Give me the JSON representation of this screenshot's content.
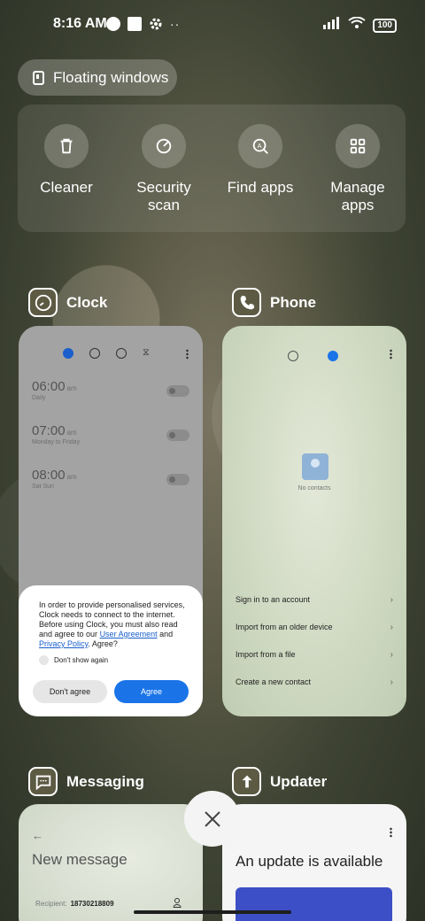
{
  "status_bar": {
    "time": "8:16 AM",
    "battery": "100",
    "icons_left": [
      "data-saver-icon",
      "notification-square-icon",
      "gear-icon",
      "more-dots-icon"
    ],
    "icons_right": [
      "signal-icon",
      "wifi-icon",
      "battery-icon"
    ]
  },
  "floating_windows": {
    "label": "Floating windows"
  },
  "quick_actions": [
    {
      "label": "Cleaner",
      "icon": "trash-icon"
    },
    {
      "label": "Security scan",
      "icon": "security-scan-icon"
    },
    {
      "label": "Find apps",
      "icon": "find-apps-icon"
    },
    {
      "label": "Manage apps",
      "icon": "grid-icon"
    }
  ],
  "apps": {
    "clock": {
      "name": "Clock",
      "alarms": [
        {
          "time": "06:00",
          "ampm": "am",
          "days": "Daily"
        },
        {
          "time": "07:00",
          "ampm": "am",
          "days": "Monday to Friday"
        },
        {
          "time": "08:00",
          "ampm": "am",
          "days": "Sat Sun"
        }
      ],
      "dialog": {
        "text_1": "In order to provide personalised services, Clock needs to connect to the internet. Before using Clock, you must also read and agree to our ",
        "link_1": "User Agreement",
        "text_2": " and ",
        "link_2": "Privacy Policy",
        "text_3": ". Agree?",
        "checkbox_label": "Don't show again",
        "disagree_label": "Don't agree",
        "agree_label": "Agree"
      }
    },
    "phone": {
      "name": "Phone",
      "empty_text": "No contacts",
      "items": [
        "Sign in to an account",
        "Import from an older device",
        "Import from a file",
        "Create a new contact"
      ]
    },
    "messaging": {
      "name": "Messaging",
      "title": "New message",
      "recipient_label": "Recipient:",
      "recipient_value": "18730218809"
    },
    "updater": {
      "name": "Updater",
      "title": "An update is available"
    }
  },
  "colors": {
    "accent": "#1a74e8",
    "clock_bg": "#a3a3a3"
  }
}
